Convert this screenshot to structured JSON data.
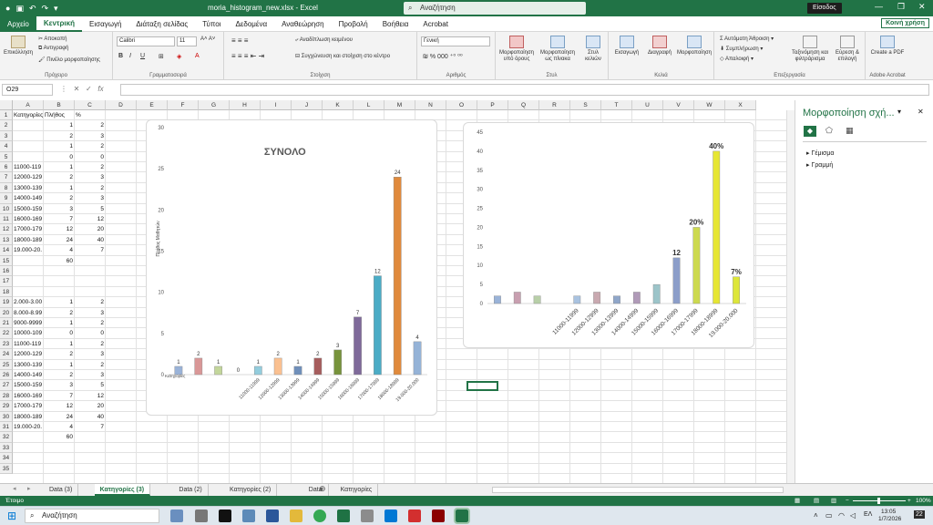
{
  "window": {
    "title": "moria_histogram_new.xlsx - Excel",
    "search": "Αναζήτηση",
    "signin": "Είσοδος"
  },
  "menu": {
    "tabs": [
      "Αρχείο",
      "Κεντρική",
      "Εισαγωγή",
      "Διάταξη σελίδας",
      "Τύποι",
      "Δεδομένα",
      "Αναθεώρηση",
      "Προβολή",
      "Βοήθεια",
      "Acrobat"
    ],
    "share": "Κοινή χρήση"
  },
  "ribbon": {
    "clipboard": {
      "paste": "Επικόλληση",
      "cut": "Αποκοπή",
      "copy": "Αντιγραφή",
      "painter": "Πινέλο μορφοποίησης",
      "label": "Πρόχειρο"
    },
    "font": {
      "name": "Calibri",
      "size": "11",
      "label": "Γραμματοσειρά",
      "bold": "B",
      "italic": "I",
      "underline": "U"
    },
    "align": {
      "wrap": "Αναδίπλωση κειμένου",
      "merge": "Συγχώνευση και στοίχιση στο κέντρο",
      "label": "Στοίχιση"
    },
    "number": {
      "format": "Γενική",
      "label": "Αριθμός"
    },
    "styles": {
      "cond": "Μορφοποίηση υπό όρους",
      "table": "Μορφοποίηση ως πίνακα",
      "cell": "Στυλ κελιών",
      "label": "Στυλ"
    },
    "cells": {
      "insert": "Εισαγωγή",
      "delete": "Διαγραφή",
      "format": "Μορφοποίηση",
      "label": "Κελιά"
    },
    "editing": {
      "autosum": "Αυτόματη Άθροιση",
      "fill": "Συμπλήρωση",
      "clear": "Απαλοιφή",
      "sort": "Ταξινόμηση και φιλτράρισμα",
      "find": "Εύρεση & επιλογή",
      "label": "Επεξεργασία"
    },
    "acrobat": {
      "create": "Create a PDF",
      "label": "Adobe Acrobat"
    }
  },
  "formula": {
    "namebox": "O29"
  },
  "columns": [
    "A",
    "B",
    "C",
    "D",
    "E",
    "F",
    "G",
    "H",
    "I",
    "J",
    "K",
    "L",
    "M",
    "N",
    "O",
    "P",
    "Q",
    "R",
    "S",
    "T",
    "U",
    "V",
    "W",
    "X"
  ],
  "rows": [
    "1",
    "2",
    "3",
    "4",
    "5",
    "6",
    "7",
    "8",
    "9",
    "10",
    "11",
    "12",
    "13",
    "14",
    "15",
    "16",
    "17",
    "18",
    "19",
    "20",
    "21",
    "22",
    "23",
    "24",
    "25",
    "26",
    "27",
    "28",
    "29",
    "30",
    "31",
    "32",
    "33",
    "34",
    "35",
    "36",
    "37",
    "38"
  ],
  "cells": [
    {
      "r": 1,
      "c": 0,
      "v": "Κατηγορίες"
    },
    {
      "r": 1,
      "c": 1,
      "v": "Πλήθος"
    },
    {
      "r": 1,
      "c": 2,
      "v": "%"
    },
    {
      "r": 2,
      "c": 1,
      "v": "1",
      "n": 1
    },
    {
      "r": 2,
      "c": 2,
      "v": "2",
      "n": 1
    },
    {
      "r": 3,
      "c": 1,
      "v": "2",
      "n": 1
    },
    {
      "r": 3,
      "c": 2,
      "v": "3",
      "n": 1
    },
    {
      "r": 4,
      "c": 1,
      "v": "1",
      "n": 1
    },
    {
      "r": 4,
      "c": 2,
      "v": "2",
      "n": 1
    },
    {
      "r": 5,
      "c": 1,
      "v": "0",
      "n": 1
    },
    {
      "r": 5,
      "c": 2,
      "v": "0",
      "n": 1
    },
    {
      "r": 6,
      "c": 0,
      "v": "11000-119"
    },
    {
      "r": 6,
      "c": 1,
      "v": "1",
      "n": 1
    },
    {
      "r": 6,
      "c": 2,
      "v": "2",
      "n": 1
    },
    {
      "r": 7,
      "c": 0,
      "v": "12000-129"
    },
    {
      "r": 7,
      "c": 1,
      "v": "2",
      "n": 1
    },
    {
      "r": 7,
      "c": 2,
      "v": "3",
      "n": 1
    },
    {
      "r": 8,
      "c": 0,
      "v": "13000-139"
    },
    {
      "r": 8,
      "c": 1,
      "v": "1",
      "n": 1
    },
    {
      "r": 8,
      "c": 2,
      "v": "2",
      "n": 1
    },
    {
      "r": 9,
      "c": 0,
      "v": "14000-149"
    },
    {
      "r": 9,
      "c": 1,
      "v": "2",
      "n": 1
    },
    {
      "r": 9,
      "c": 2,
      "v": "3",
      "n": 1
    },
    {
      "r": 10,
      "c": 0,
      "v": "15000-159"
    },
    {
      "r": 10,
      "c": 1,
      "v": "3",
      "n": 1
    },
    {
      "r": 10,
      "c": 2,
      "v": "5",
      "n": 1
    },
    {
      "r": 11,
      "c": 0,
      "v": "16000-169"
    },
    {
      "r": 11,
      "c": 1,
      "v": "7",
      "n": 1
    },
    {
      "r": 11,
      "c": 2,
      "v": "12",
      "n": 1
    },
    {
      "r": 12,
      "c": 0,
      "v": "17000-179"
    },
    {
      "r": 12,
      "c": 1,
      "v": "12",
      "n": 1
    },
    {
      "r": 12,
      "c": 2,
      "v": "20",
      "n": 1
    },
    {
      "r": 13,
      "c": 0,
      "v": "18000-189"
    },
    {
      "r": 13,
      "c": 1,
      "v": "24",
      "n": 1
    },
    {
      "r": 13,
      "c": 2,
      "v": "40",
      "n": 1
    },
    {
      "r": 14,
      "c": 0,
      "v": "19.000-20."
    },
    {
      "r": 14,
      "c": 1,
      "v": "4",
      "n": 1
    },
    {
      "r": 14,
      "c": 2,
      "v": "7",
      "n": 1
    },
    {
      "r": 15,
      "c": 1,
      "v": "60",
      "n": 1
    },
    {
      "r": 19,
      "c": 0,
      "v": "2.000-3.00"
    },
    {
      "r": 19,
      "c": 1,
      "v": "1",
      "n": 1
    },
    {
      "r": 19,
      "c": 2,
      "v": "2",
      "n": 1
    },
    {
      "r": 20,
      "c": 0,
      "v": "8.000-8.99"
    },
    {
      "r": 20,
      "c": 1,
      "v": "2",
      "n": 1
    },
    {
      "r": 20,
      "c": 2,
      "v": "3",
      "n": 1
    },
    {
      "r": 21,
      "c": 0,
      "v": "9000-9999"
    },
    {
      "r": 21,
      "c": 1,
      "v": "1",
      "n": 1
    },
    {
      "r": 21,
      "c": 2,
      "v": "2",
      "n": 1
    },
    {
      "r": 22,
      "c": 0,
      "v": "10000-109"
    },
    {
      "r": 22,
      "c": 1,
      "v": "0",
      "n": 1
    },
    {
      "r": 22,
      "c": 2,
      "v": "0",
      "n": 1
    },
    {
      "r": 23,
      "c": 0,
      "v": "11000-119"
    },
    {
      "r": 23,
      "c": 1,
      "v": "1",
      "n": 1
    },
    {
      "r": 23,
      "c": 2,
      "v": "2",
      "n": 1
    },
    {
      "r": 24,
      "c": 0,
      "v": "12000-129"
    },
    {
      "r": 24,
      "c": 1,
      "v": "2",
      "n": 1
    },
    {
      "r": 24,
      "c": 2,
      "v": "3",
      "n": 1
    },
    {
      "r": 25,
      "c": 0,
      "v": "13000-139"
    },
    {
      "r": 25,
      "c": 1,
      "v": "1",
      "n": 1
    },
    {
      "r": 25,
      "c": 2,
      "v": "2",
      "n": 1
    },
    {
      "r": 26,
      "c": 0,
      "v": "14000-149"
    },
    {
      "r": 26,
      "c": 1,
      "v": "2",
      "n": 1
    },
    {
      "r": 26,
      "c": 2,
      "v": "3",
      "n": 1
    },
    {
      "r": 27,
      "c": 0,
      "v": "15000-159"
    },
    {
      "r": 27,
      "c": 1,
      "v": "3",
      "n": 1
    },
    {
      "r": 27,
      "c": 2,
      "v": "5",
      "n": 1
    },
    {
      "r": 28,
      "c": 0,
      "v": "16000-169"
    },
    {
      "r": 28,
      "c": 1,
      "v": "7",
      "n": 1
    },
    {
      "r": 28,
      "c": 2,
      "v": "12",
      "n": 1
    },
    {
      "r": 29,
      "c": 0,
      "v": "17000-179"
    },
    {
      "r": 29,
      "c": 1,
      "v": "12",
      "n": 1
    },
    {
      "r": 29,
      "c": 2,
      "v": "20",
      "n": 1
    },
    {
      "r": 30,
      "c": 0,
      "v": "18000-189"
    },
    {
      "r": 30,
      "c": 1,
      "v": "24",
      "n": 1
    },
    {
      "r": 30,
      "c": 2,
      "v": "40",
      "n": 1
    },
    {
      "r": 31,
      "c": 0,
      "v": "19.000-20."
    },
    {
      "r": 31,
      "c": 1,
      "v": "4",
      "n": 1
    },
    {
      "r": 31,
      "c": 2,
      "v": "7",
      "n": 1
    },
    {
      "r": 32,
      "c": 1,
      "v": "60",
      "n": 1
    }
  ],
  "chart_data": [
    {
      "type": "bar",
      "title": "ΣΥΝΟΛΟ",
      "ylabel": "Πλήθος Μαθητών",
      "xlabel": "Κατηγορίες",
      "ylim": [
        0,
        30
      ],
      "yticks": [
        0,
        5,
        10,
        15,
        20,
        25,
        30
      ],
      "categories": [
        "",
        "",
        "",
        "",
        "11000-11999",
        "12000-12999",
        "13000-13999",
        "14000-14999",
        "15000-15999",
        "16000-16999",
        "17000-17999",
        "18000-18999",
        "19.000-20.000"
      ],
      "values": [
        1,
        2,
        1,
        0,
        1,
        2,
        1,
        2,
        3,
        7,
        12,
        24,
        4
      ],
      "labels": [
        "1",
        "2",
        "1",
        "0",
        "1",
        "2",
        "1",
        "2",
        "3",
        "7",
        "12",
        "24",
        "4"
      ],
      "colors": [
        "#9ab3d8",
        "#d99797",
        "#c3d69b",
        "#b3a2c7",
        "#93cddd",
        "#fac090",
        "#6f8fba",
        "#a65d5d",
        "#77933c",
        "#7f6a9a",
        "#4bacc6",
        "#e08a3c",
        "#95b3d7"
      ]
    },
    {
      "type": "bar",
      "title": "",
      "ylim": [
        0,
        45
      ],
      "yticks": [
        0,
        5,
        10,
        15,
        20,
        25,
        30,
        35,
        40,
        45
      ],
      "categories": [
        "",
        "",
        "",
        "",
        "11000-11999",
        "12000-12999",
        "13000-13999",
        "14000-14999",
        "15000-15999",
        "16000-16999",
        "17000-17999",
        "18000-18999",
        "19.000-20.000"
      ],
      "values": [
        2,
        3,
        2,
        0,
        2,
        3,
        2,
        3,
        5,
        12,
        20,
        40,
        7
      ],
      "labels": [
        "",
        "",
        "",
        "",
        "",
        "",
        "",
        "",
        "",
        "12",
        "20%",
        "40%",
        "7%"
      ],
      "colors": [
        "#9ab3d8",
        "#c89fb0",
        "#b8cfa8",
        "#ffffff",
        "#a9c2e0",
        "#c9a9b0",
        "#8fa6c9",
        "#b09ab8",
        "#9cc4c9",
        "#8c9ec9",
        "#ccd94f",
        "#e6e632",
        "#dde639"
      ]
    }
  ],
  "sheets": {
    "tabs": [
      "Data (3)",
      "Κατηγορίες (3)",
      "Data (2)",
      "Κατηγορίες (2)",
      "Data",
      "Κατηγορίες"
    ],
    "active": 1
  },
  "status": {
    "ready": "Έτοιμο",
    "zoom": "100%"
  },
  "pane": {
    "title": "Μορφοποίηση σχή...",
    "items": [
      "Γέμισμα",
      "Γραμμή"
    ]
  },
  "taskbar": {
    "search": "Αναζήτηση",
    "time": "13:05",
    "date": "1/7/2026",
    "lang": "ΕΛ",
    "badge": "22"
  }
}
